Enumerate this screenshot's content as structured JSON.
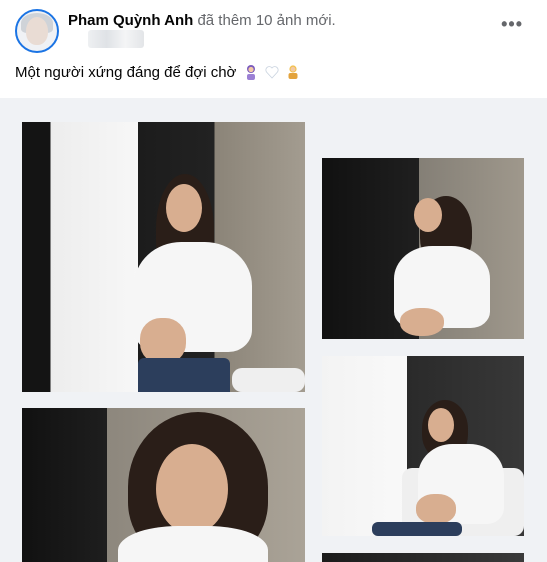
{
  "post": {
    "author": "Pham Quỳnh Anh",
    "action_text": "đã thêm 10 ảnh mới.",
    "caption": "Một người xứng đáng để đợi chờ",
    "caption_emojis": [
      "woman-emoji",
      "heart-emoji",
      "baby-emoji"
    ],
    "more_label": "•••"
  },
  "photos": [
    {
      "name": "photo-woman-by-window"
    },
    {
      "name": "photo-woman-looking-up"
    },
    {
      "name": "photo-woman-on-sofa"
    },
    {
      "name": "photo-woman-portrait"
    },
    {
      "name": "photo-partial"
    }
  ]
}
